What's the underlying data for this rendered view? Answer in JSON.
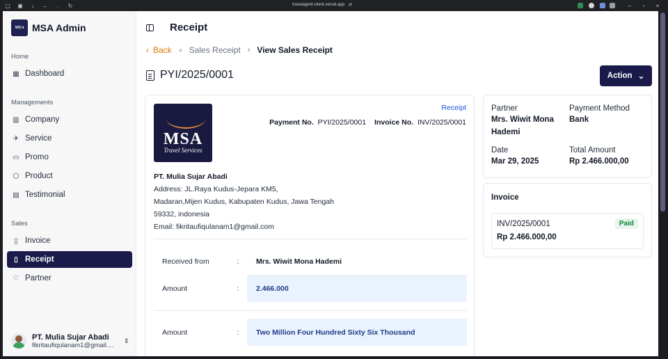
{
  "browser": {
    "url": "travelagent-client.vercel.app"
  },
  "sidebar": {
    "brand": "MSA Admin",
    "brand_logo_text": "MSA",
    "sections": {
      "home": "Home",
      "managements": "Managements",
      "sales": "Sales"
    },
    "items": [
      {
        "label": "Dashboard",
        "icon": "dashboard-icon"
      },
      {
        "label": "Company",
        "icon": "building-icon"
      },
      {
        "label": "Service",
        "icon": "plane-icon"
      },
      {
        "label": "Promo",
        "icon": "ticket-icon"
      },
      {
        "label": "Product",
        "icon": "box-icon"
      },
      {
        "label": "Testimonial",
        "icon": "message-icon"
      },
      {
        "label": "Invoice",
        "icon": "document-icon"
      },
      {
        "label": "Receipt",
        "icon": "receipt-icon",
        "active": true
      },
      {
        "label": "Partner",
        "icon": "handshake-icon"
      }
    ],
    "user": {
      "name": "PT. Mulia Sujar Abadi",
      "email": "fikritaufiqulanam1@gmail...."
    }
  },
  "header": {
    "title": "Receipt"
  },
  "breadcrumb": {
    "back": "Back",
    "parent": "Sales Receipt",
    "current": "View Sales Receipt"
  },
  "document": {
    "number": "PYI/2025/0001",
    "action_label": "Action"
  },
  "receipt": {
    "tag": "Receipt",
    "logo": {
      "main": "MSA",
      "sub": "Travel Services"
    },
    "payment_no_label": "Payment No.",
    "payment_no": "PYI/2025/0001",
    "invoice_no_label": "Invoice No.",
    "invoice_no": "INV/2025/0001",
    "company_name": "PT. Mulia Sujar Abadi",
    "address_line1": "Address: JL.Raya Kudus-Jepara KM5,",
    "address_line2": "Madaran,Mijen Kudus, Kabupaten Kudus, Jawa Tengah",
    "address_line3": "59332, indonesia",
    "email_line": "Email: fikritaufiqulanam1@gmail.com",
    "received_from_label": "Received from",
    "received_from": "Mrs. Wiwit Mona Hademi",
    "amount_label": "Amount",
    "amount": "2.466.000",
    "amount_words_label": "Amount",
    "amount_words": "Two Million Four Hundred Sixty Six Thousand",
    "colon": ":"
  },
  "info": {
    "partner_label": "Partner",
    "partner_line1": "Mrs. Wiwit Mona",
    "partner_line2": "Hademi",
    "payment_method_label": "Payment Method",
    "payment_method": "Bank",
    "date_label": "Date",
    "date": "Mar 29, 2025",
    "total_label": "Total Amount",
    "total": "Rp 2.466.000,00"
  },
  "invoice": {
    "title": "Invoice",
    "item_no": "INV/2025/0001",
    "item_amount": "Rp 2.466.000,00",
    "status": "Paid"
  }
}
